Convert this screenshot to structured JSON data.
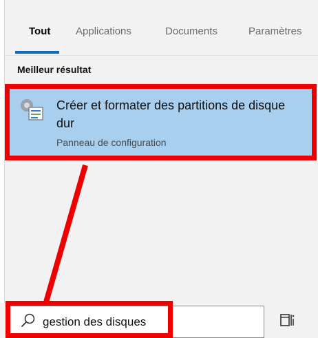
{
  "tabs": [
    {
      "label": "Tout"
    },
    {
      "label": "Applications"
    },
    {
      "label": "Documents"
    },
    {
      "label": "Paramètres"
    }
  ],
  "section_label": "Meilleur résultat",
  "best_result": {
    "title": "Créer et formater des partitions de disque dur",
    "subtitle": "Panneau de configuration",
    "icon": "disk-management-icon"
  },
  "search": {
    "value": "gestion des disques",
    "icon": "search-icon"
  },
  "task_view_icon": "task-view-icon",
  "colors": {
    "highlight": "#ee0000",
    "selection": "#a8cfee",
    "accent": "#0f6cbd"
  }
}
